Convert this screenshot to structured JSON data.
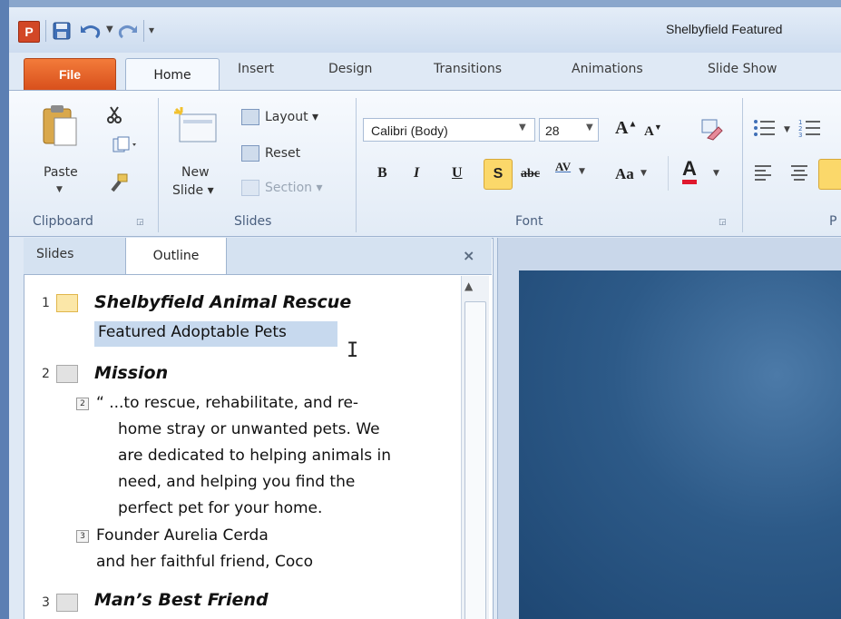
{
  "window": {
    "title": "Shelbyfield Featured"
  },
  "qat": {
    "app_icon": "P",
    "save_icon": "save-icon",
    "undo_icon": "undo-icon",
    "redo_icon": "redo-icon",
    "customize": "▾"
  },
  "tabs": [
    {
      "label": "File"
    },
    {
      "label": "Home"
    },
    {
      "label": "Insert"
    },
    {
      "label": "Design"
    },
    {
      "label": "Transitions"
    },
    {
      "label": "Animations"
    },
    {
      "label": "Slide Show"
    }
  ],
  "ribbon": {
    "clipboard": {
      "paste": "Paste",
      "group_label": "Clipboard"
    },
    "slides": {
      "new_slide_line1": "New",
      "new_slide_line2": "Slide ▾",
      "layout": "Layout ▾",
      "reset": "Reset",
      "section": "Section ▾",
      "group_label": "Slides"
    },
    "font": {
      "name": "Calibri (Body)",
      "size": "28",
      "bold": "B",
      "italic": "I",
      "underline": "U",
      "shadow": "S",
      "strike": "abc",
      "char_spacing": "AV",
      "change_case": "Aa",
      "font_color": "A",
      "grow": "A",
      "shrink": "A",
      "group_label": "Font"
    },
    "paragraph": {
      "group_label": "P"
    }
  },
  "pane": {
    "tab_slides": "Slides",
    "tab_outline": "Outline",
    "close": "×",
    "slides": [
      {
        "num": "1",
        "title": "Shelbyfield  Animal  Rescue",
        "body": [
          "Featured Adoptable Pets"
        ]
      },
      {
        "num": "2",
        "title": "Mission",
        "bullets": [
          {
            "level": "2",
            "lines": [
              "“ ...to rescue, rehabilitate, and re-",
              "home stray or unwanted pets. We",
              "are dedicated to helping animals in",
              "need, and helping you find the",
              "perfect pet for your home."
            ]
          },
          {
            "level": "3",
            "lines": [
              "Founder Aurelia Cerda",
              "and her faithful friend, Coco"
            ]
          }
        ]
      },
      {
        "num": "3",
        "title": "Man’s Best Friend"
      }
    ]
  },
  "colors": {
    "file_tab": "#d8501c",
    "ribbon": "#e2ebf6",
    "slide_bg": "#2d5a88",
    "selection": "#c7d9ee"
  }
}
